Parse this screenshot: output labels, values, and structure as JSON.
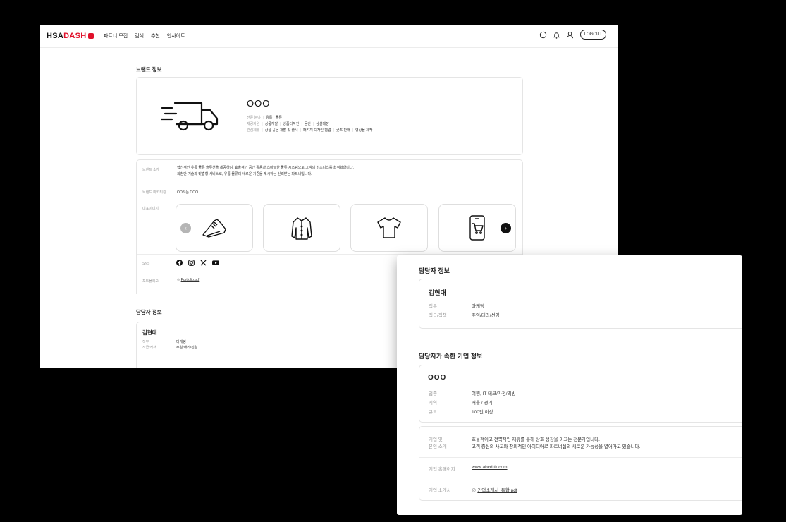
{
  "header": {
    "logo_main": "HSA",
    "logo_accent": "DASH",
    "nav": [
      "파트너 모집",
      "검색",
      "추천",
      "인사이트"
    ],
    "logout_label": "LOGOUT"
  },
  "brand": {
    "section_title": "브랜드 정보",
    "name": "OOO",
    "fields": [
      {
        "label": "전문 분야",
        "values": [
          "유통 · 물류"
        ]
      },
      {
        "label": "제공자원",
        "values": [
          "상품개발",
          "상품디자인",
          "공간",
          "상설매장"
        ]
      },
      {
        "label": "관심제휴",
        "values": [
          "상품 공동 개발 및 출시",
          "패키지 디자인 협업",
          "굿즈 판매",
          "영상물 제작"
        ]
      }
    ],
    "intro_label": "브랜드 소개",
    "intro_lines": [
      "혁신적인 유통 물류 솔루션을 제공하며, 효율적인 공간 활용과 스마트한 물류 시스템으로 고객의 비즈니스를 최적화합니다.",
      "최첨단 기술과 맞춤형 서비스로, 유통 물류의 새로운 기준을 제시하는 신뢰받는 파트너입니다."
    ],
    "mascot_label": "브랜드 마키티킹",
    "mascot_value": "OO하는 OOO",
    "images_label": "대표이미지",
    "images": [
      "sneaker-icon",
      "shirt-icon",
      "tshirt-icon",
      "phone-cart-icon"
    ],
    "sns_label": "SNS",
    "sns": [
      "facebook-icon",
      "instagram-icon",
      "x-icon",
      "youtube-icon"
    ],
    "portfolio_label": "포트폴리오",
    "portfolio_file": "Portfolio.pdf"
  },
  "manager": {
    "section_title": "담당자 정보",
    "name": "김현대",
    "fields": [
      {
        "label": "직무",
        "value": "마케팅"
      },
      {
        "label": "직급/직책",
        "value": "주임/대리/선임"
      }
    ]
  },
  "company": {
    "section_title": "담당자가 속한 기업 정보",
    "name": "OOO",
    "fields": [
      {
        "label": "업종",
        "value": "여행, IT 테크/가전/리빙"
      },
      {
        "label": "지역",
        "value": "서울 / 경기"
      },
      {
        "label": "규모",
        "value": "100인 이상"
      }
    ],
    "intro_label_1": "기업 및",
    "intro_label_2": "본인 소개",
    "intro_lines": [
      "효율적이고 전략적인 제휴를 통해 상호 성장을 이끄는 전문가입니다.",
      "고객 중심의 사고와 창의적인 아이디어로 파트너십의 새로운 가능성을 열어가고 있습니다."
    ],
    "homepage_label": "기업 홈페이지",
    "homepage": "www.abcd.tk.com",
    "brochure_label": "기업 소개서",
    "brochure_file": "기업소개서_통합.pdf"
  },
  "colors": {
    "accent": "#e0102a",
    "background": "#000000",
    "border": "#e5e5e5"
  }
}
